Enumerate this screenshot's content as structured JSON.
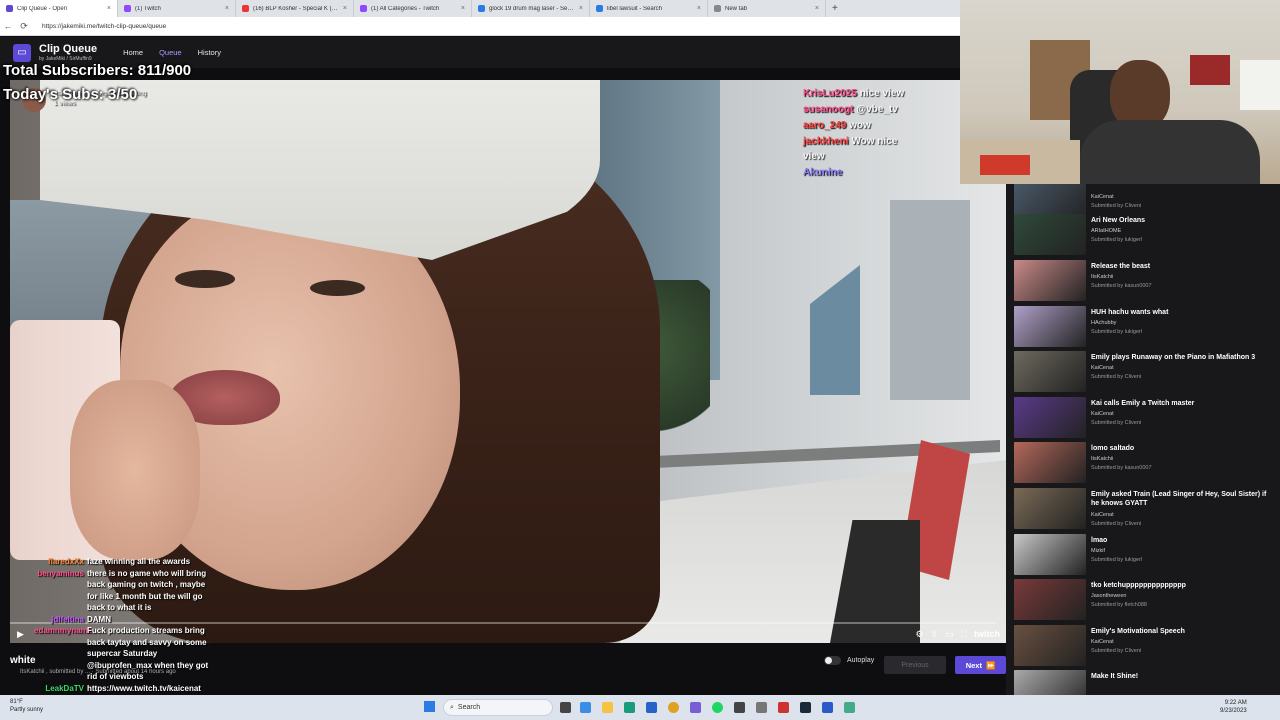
{
  "browser": {
    "tabs": [
      {
        "label": "Clip Queue - Open",
        "color": "#5c4ad6",
        "active": true
      },
      {
        "label": "(1) Twitch",
        "color": "#9146ff"
      },
      {
        "label": "(16) BLP Kosher - Special K (Offic...",
        "color": "#e33"
      },
      {
        "label": "(1) All Categories - Twitch",
        "color": "#9146ff"
      },
      {
        "label": "glock 19 drum mag laser - Search",
        "color": "#2a7be4"
      },
      {
        "label": "libel lawsuit - Search",
        "color": "#2a7be4"
      },
      {
        "label": "New tab",
        "color": "#888"
      }
    ],
    "new_tab_symbol": "+",
    "url": "https://jakemiki.me/twitch-clip-queue/queue"
  },
  "header": {
    "title": "Clip Queue",
    "subtitle": "by JakeMiki / SirMuffin9",
    "nav": [
      {
        "label": "Home"
      },
      {
        "label": "Queue",
        "active": true
      },
      {
        "label": "History"
      }
    ]
  },
  "overlay": {
    "total_subs": "Total Subscribers: 811/900",
    "today_subs": "Today's Subs: 3/50"
  },
  "current_clip": {
    "channel_line": "ItsKatchii · playing Just Chatting",
    "views": "1 views",
    "title": "white",
    "meta": "ItsKatchii , submitted by ... · Submitted about 14 hours ago"
  },
  "chat_top": [
    {
      "user": "KrisLu2025",
      "text": "nice view",
      "color": "#ff4f8b"
    },
    {
      "user": "susanoogt",
      "text": "@vbe_tv",
      "color": "#ff4f8b"
    },
    {
      "user": "aaro_249",
      "text": "wow",
      "color": "#ff4040"
    },
    {
      "user": "jackkheni",
      "text": "Wow nice",
      "color": "#ff4040"
    },
    {
      "user": "",
      "text": "view",
      "color": "#ffffff"
    },
    {
      "user": "Akunine",
      "text": "",
      "color": "#8a7cff"
    }
  ],
  "chat_bottom": [
    {
      "user": "flaredxXx",
      "text": "faze winning all the awards",
      "color": "#ff8a3c"
    },
    {
      "user": "benyaminus",
      "text": "there is no game who will bring",
      "color": "#ff4f8b"
    },
    {
      "user": "",
      "text": "back gaming on twitch , maybe"
    },
    {
      "user": "",
      "text": "for like 1 month but the will go"
    },
    {
      "user": "",
      "text": "back to what it is"
    },
    {
      "user": "jdlfeltina",
      "text": "DAMN",
      "color": "#c85cff"
    },
    {
      "user": "edamnmyname",
      "text": "Fuck production streams bring",
      "color": "#ff4f8b"
    },
    {
      "user": "",
      "text": "back taytay and savvy on some"
    },
    {
      "user": "",
      "text": "supercar Saturday"
    },
    {
      "user": "",
      "text": "@ibuprofen_max when they got"
    },
    {
      "user": "",
      "text": "rid of viewbots"
    },
    {
      "user": "LeakDaTV",
      "text": "https://www.twitch.tv/kaicenat",
      "color": "#3cd96a"
    }
  ],
  "player": {
    "autoplay_label": "Autoplay",
    "prev_label": "Previous",
    "next_label": "Next",
    "twitch_label": "twitch"
  },
  "queue": [
    {
      "title": "",
      "channel": "KaiCenat",
      "submitter": "Submitted by Cliveni",
      "thumb": "#4a5a6a"
    },
    {
      "title": "Ari New Orleans",
      "channel": "ARIatHOME",
      "submitter": "Submitted by lukigerl",
      "thumb": "#2f4a3a"
    },
    {
      "title": "Release the beast",
      "channel": "ItsKatchii",
      "submitter": "Submitted by kasun0007",
      "thumb": "#c98a88"
    },
    {
      "title": "HUH hachu wants what",
      "channel": "HAchubby",
      "submitter": "Submitted by lukigerl",
      "thumb": "#b0a0c8"
    },
    {
      "title": "Emily plays Runaway on the Piano in Mafiathon 3",
      "channel": "KaiCenat",
      "submitter": "Submitted by Cliveni",
      "thumb": "#6d6a5e"
    },
    {
      "title": "Kai calls Emily a Twitch master",
      "channel": "KaiCenat",
      "submitter": "Submitted by Cliveni",
      "thumb": "#5b3a8a"
    },
    {
      "title": "lomo saltado",
      "channel": "ItsKatchii",
      "submitter": "Submitted by kasun0007",
      "thumb": "#b4685a"
    },
    {
      "title": "Emily asked Train (Lead Singer of Hey, Soul Sister) if he knows GYATT",
      "channel": "KaiCenat",
      "submitter": "Submitted by Cliveni",
      "thumb": "#7a6a55"
    },
    {
      "title": "lmao",
      "channel": "Mizkif",
      "submitter": "Submitted by lukigerl",
      "thumb": "#c8c8c8"
    },
    {
      "title": "tko ketchupppppppppppppp",
      "channel": "Jasontheween",
      "submitter": "Submitted by fletch088",
      "thumb": "#7a3a3a"
    },
    {
      "title": "Emily's Motivational Speech",
      "channel": "KaiCenat",
      "submitter": "Submitted by Cliveni",
      "thumb": "#6a5040"
    },
    {
      "title": "Make It Shine!",
      "channel": "",
      "submitter": "",
      "thumb": "#aaaaaa"
    }
  ],
  "taskbar": {
    "weather_temp": "81°F",
    "weather_desc": "Partly sunny",
    "search_label": "Search",
    "time": "9:22 AM",
    "date": "9/23/2023"
  },
  "colors": {
    "accent": "#5c4ad6",
    "page_bg": "#0e0e10",
    "sidebar_bg": "#18181b"
  }
}
